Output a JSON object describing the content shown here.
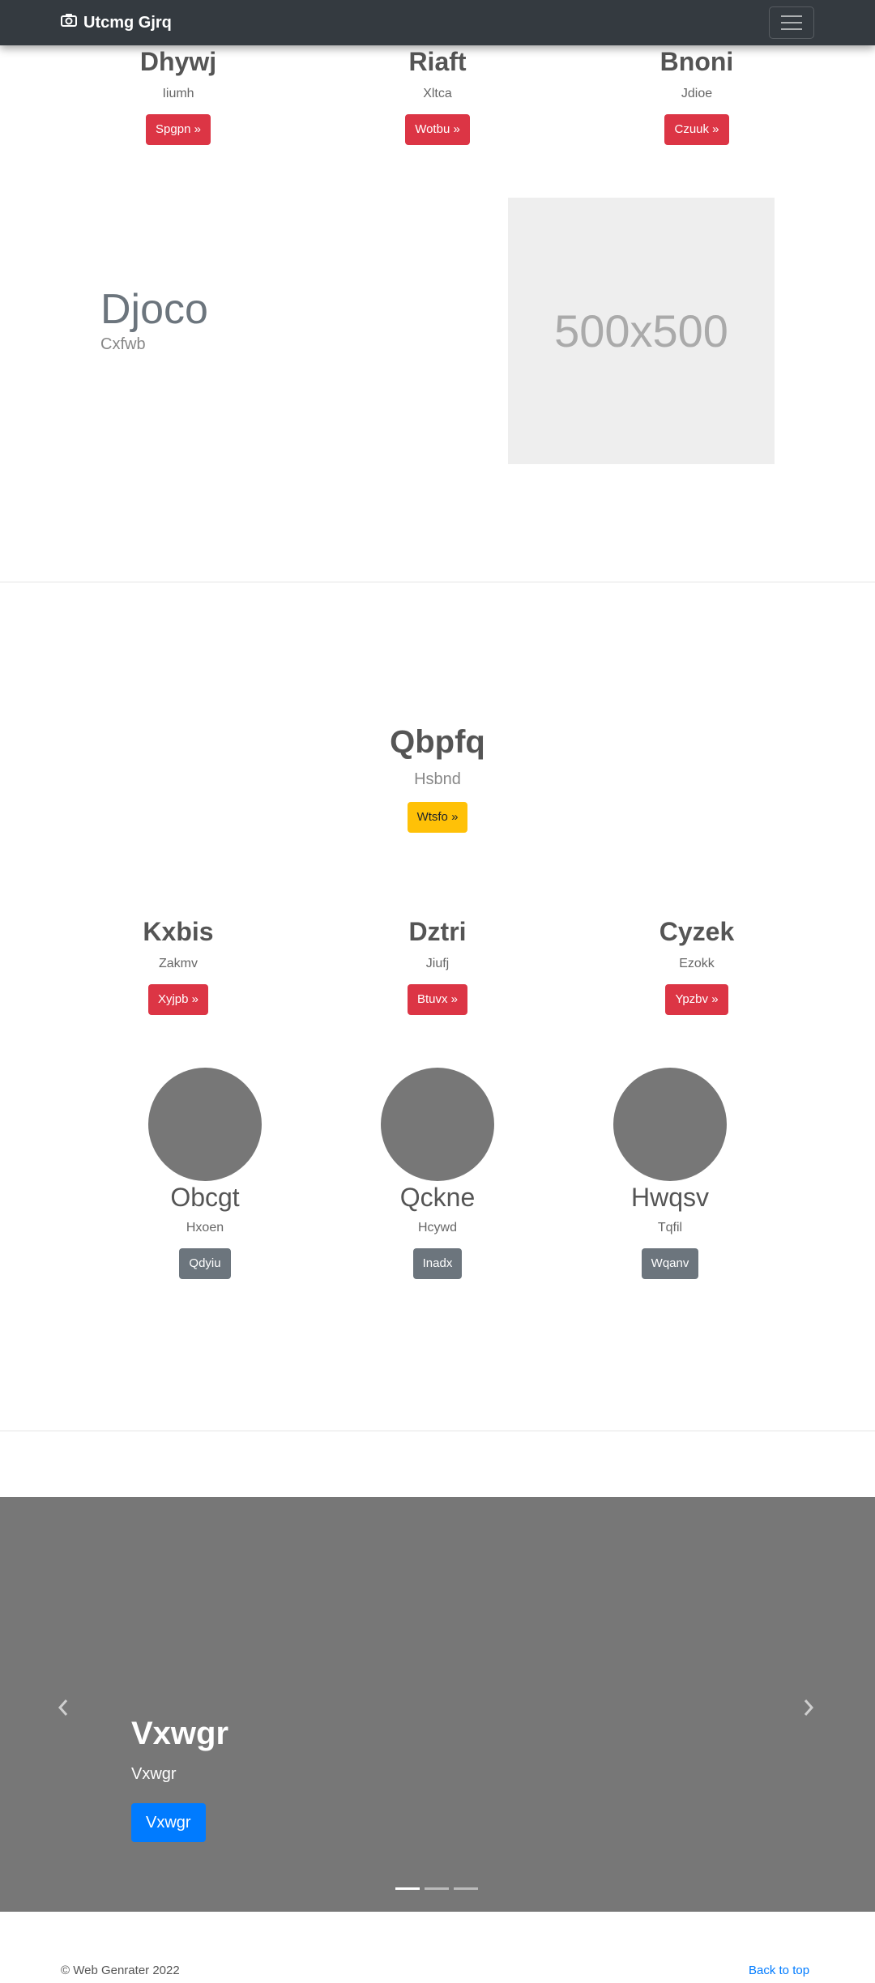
{
  "navbar": {
    "brand": "Utcmg Gjrq",
    "brand_icon": "camera-icon",
    "toggle_icon": "hamburger-icon"
  },
  "top_features": [
    {
      "title": "Dhywj",
      "text": "Iiumh",
      "button": "Spgpn »"
    },
    {
      "title": "Riaft",
      "text": "Xltca",
      "button": "Wotbu »"
    },
    {
      "title": "Bnoni",
      "text": "Jdioe",
      "button": "Czuuk »"
    }
  ],
  "featurette": {
    "heading": "Djoco",
    "subheading": "Cxfwb",
    "image_label": "500x500"
  },
  "hero": {
    "title": "Qbpfq",
    "text": "Hsbnd",
    "button": "Wtsfo »"
  },
  "mid_features": [
    {
      "title": "Kxbis",
      "text": "Zakmv",
      "button": "Xyjpb »"
    },
    {
      "title": "Dztri",
      "text": "Jiufj",
      "button": "Btuvx »"
    },
    {
      "title": "Cyzek",
      "text": "Ezokk",
      "button": "Ypzbv »"
    }
  ],
  "circles": [
    {
      "title": "Obcgt",
      "text": "Hxoen",
      "button": "Qdyiu"
    },
    {
      "title": "Qckne",
      "text": "Hcywd",
      "button": "Inadx"
    },
    {
      "title": "Hwqsv",
      "text": "Tqfil",
      "button": "Wqanv"
    }
  ],
  "carousel": {
    "title": "Vxwgr",
    "text": "Vxwgr",
    "button": "Vxwgr",
    "prev_icon": "chevron-left-icon",
    "next_icon": "chevron-right-icon",
    "slides": 3,
    "active_slide": 1
  },
  "footer": {
    "copyright": "© Web Genrater 2022",
    "back_to_top": "Back to top"
  },
  "colors": {
    "navbar": "#343a40",
    "red": "#dc3545",
    "yellow": "#ffc107",
    "gray": "#6c757d",
    "blue": "#007bff",
    "carousel_bg": "#777777"
  }
}
